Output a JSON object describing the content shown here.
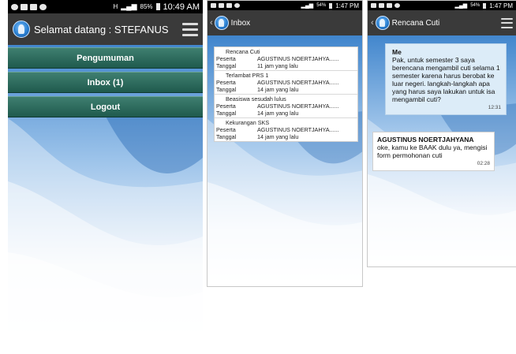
{
  "phone1": {
    "status": {
      "time": "10:49 AM",
      "battery": "85%",
      "network": "H"
    },
    "title": "Selamat datang : STEFANUS",
    "menu": [
      "Pengumuman",
      "Inbox (1)",
      "Logout"
    ]
  },
  "phone2": {
    "status": {
      "time": "1:47 PM",
      "battery": "54%"
    },
    "title": "Inbox",
    "items": [
      {
        "subject": "Rencana Cuti",
        "peserta_label": "Peserta",
        "peserta": "AGUSTINUS NOERTJAHYA......",
        "tanggal_label": "Tanggal",
        "tanggal": "11 jam yang lalu"
      },
      {
        "subject": "Terlambat PRS 1",
        "peserta_label": "Peserta",
        "peserta": "AGUSTINUS NOERTJAHYA......",
        "tanggal_label": "Tanggal",
        "tanggal": "14 jam yang lalu"
      },
      {
        "subject": "Beasiswa sesudah lulus",
        "peserta_label": "Peserta",
        "peserta": "AGUSTINUS NOERTJAHYA......",
        "tanggal_label": "Tanggal",
        "tanggal": "14 jam yang lalu"
      },
      {
        "subject": "Kekurangan SKS",
        "peserta_label": "Peserta",
        "peserta": "AGUSTINUS NOERTJAHYA......",
        "tanggal_label": "Tanggal",
        "tanggal": "14 jam yang lalu"
      }
    ]
  },
  "phone3": {
    "status": {
      "time": "1:47 PM",
      "battery": "54%"
    },
    "title": "Rencana Cuti",
    "messages": [
      {
        "sender": "Me",
        "text": "Pak, untuk semester 3 saya berencana mengambil cuti selama 1 semester karena harus berobat ke luar negeri. langkah-langkah apa yang harus saya lakukan untuk isa mengambil cuti?",
        "time": "12:31"
      },
      {
        "sender": "AGUSTINUS NOERTJAHYANA",
        "text": "oke, kamu ke BAAK dulu ya, mengisi form permohonan cuti",
        "time": "02:28"
      }
    ]
  },
  "colors": {
    "titlebar": "#3a3a3a",
    "menu_button": "#2d6b5d",
    "bubble_me": "#dcecf8",
    "bubble_other": "#ffffff"
  }
}
